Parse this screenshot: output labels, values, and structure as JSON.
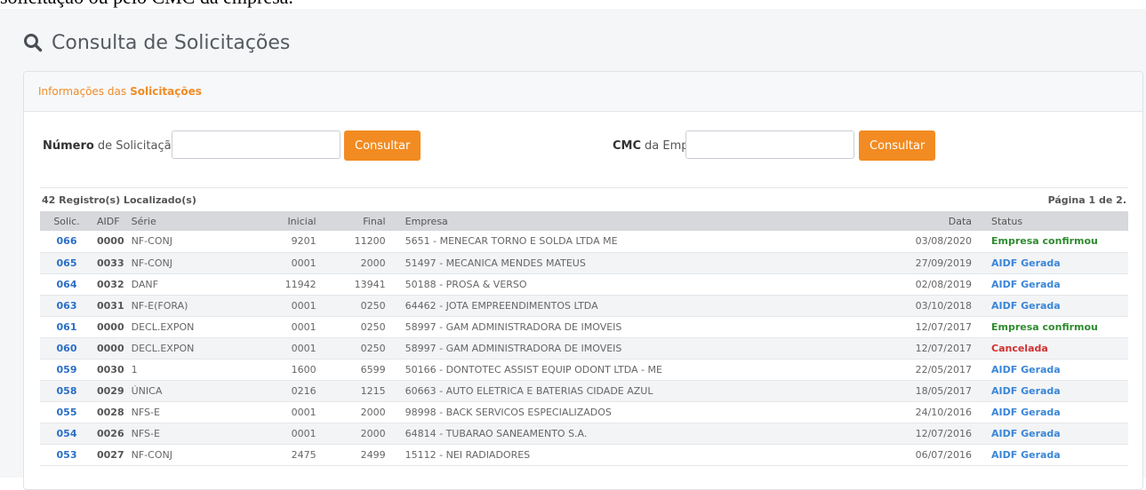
{
  "doc_fragment": "solicitação ou pelo CMC da empresa.",
  "page_title": "Consulta de Solicitações",
  "panel": {
    "title_prefix": "Informações das",
    "title_bold": "Solicitações"
  },
  "search": {
    "numero_bold": "Número",
    "numero_rest": "de Solicitação",
    "numero_value": "",
    "numero_button": "Consultar",
    "cmc_bold": "CMC",
    "cmc_rest": "da Empresa",
    "cmc_value": "",
    "cmc_button": "Consultar"
  },
  "results": {
    "count": "42 Registro(s) Localizado(s)",
    "page": "Página 1 de 2."
  },
  "table": {
    "headers": [
      "Solic.",
      "AIDF",
      "Série",
      "Inicial",
      "Final",
      "Empresa",
      "Data",
      "Status"
    ],
    "rows": [
      {
        "solic": "066",
        "aidf": "0000",
        "serie": "NF-CONJ",
        "inicial": "9201",
        "final": "11200",
        "empresa": "5651 - MENECAR TORNO E SOLDA LTDA ME",
        "data": "03/08/2020",
        "status": "Empresa confirmou",
        "status_color": "#2e8b2e"
      },
      {
        "solic": "065",
        "aidf": "0033",
        "serie": "NF-CONJ",
        "inicial": "0001",
        "final": "2000",
        "empresa": "51497 - MECANICA MENDES MATEUS",
        "data": "27/09/2019",
        "status": "AIDF Gerada",
        "status_color": "#3a86d8"
      },
      {
        "solic": "064",
        "aidf": "0032",
        "serie": "DANF",
        "inicial": "11942",
        "final": "13941",
        "empresa": "50188 - PROSA & VERSO",
        "data": "02/08/2019",
        "status": "AIDF Gerada",
        "status_color": "#3a86d8"
      },
      {
        "solic": "063",
        "aidf": "0031",
        "serie": "NF-E(FORA)",
        "inicial": "0001",
        "final": "0250",
        "empresa": "64462 - JOTA EMPREENDIMENTOS LTDA",
        "data": "03/10/2018",
        "status": "AIDF Gerada",
        "status_color": "#3a86d8"
      },
      {
        "solic": "061",
        "aidf": "0000",
        "serie": "DECL.EXPON",
        "inicial": "0001",
        "final": "0250",
        "empresa": "58997 - GAM ADMINISTRADORA DE IMOVEIS",
        "data": "12/07/2017",
        "status": "Empresa confirmou",
        "status_color": "#2e8b2e"
      },
      {
        "solic": "060",
        "aidf": "0000",
        "serie": "DECL.EXPON",
        "inicial": "0001",
        "final": "0250",
        "empresa": "58997 - GAM ADMINISTRADORA DE IMOVEIS",
        "data": "12/07/2017",
        "status": "Cancelada",
        "status_color": "#d03030"
      },
      {
        "solic": "059",
        "aidf": "0030",
        "serie": "1",
        "inicial": "1600",
        "final": "6599",
        "empresa": "50166 - DONTOTEC ASSIST EQUIP ODONT LTDA - ME",
        "data": "22/05/2017",
        "status": "AIDF Gerada",
        "status_color": "#3a86d8"
      },
      {
        "solic": "058",
        "aidf": "0029",
        "serie": "ÚNICA",
        "inicial": "0216",
        "final": "1215",
        "empresa": "60663 - AUTO ELETRICA E BATERIAS CIDADE AZUL",
        "data": "18/05/2017",
        "status": "AIDF Gerada",
        "status_color": "#3a86d8"
      },
      {
        "solic": "055",
        "aidf": "0028",
        "serie": "NFS-E",
        "inicial": "0001",
        "final": "2000",
        "empresa": "98998 - BACK SERVICOS ESPECIALIZADOS",
        "data": "24/10/2016",
        "status": "AIDF Gerada",
        "status_color": "#3a86d8"
      },
      {
        "solic": "054",
        "aidf": "0026",
        "serie": "NFS-E",
        "inicial": "0001",
        "final": "2000",
        "empresa": "64814 - TUBARAO SANEAMENTO S.A.",
        "data": "12/07/2016",
        "status": "AIDF Gerada",
        "status_color": "#3a86d8"
      },
      {
        "solic": "053",
        "aidf": "0027",
        "serie": "NF-CONJ",
        "inicial": "2475",
        "final": "2499",
        "empresa": "15112 - NEI RADIADORES",
        "data": "06/07/2016",
        "status": "AIDF Gerada",
        "status_color": "#3a86d8"
      }
    ]
  }
}
